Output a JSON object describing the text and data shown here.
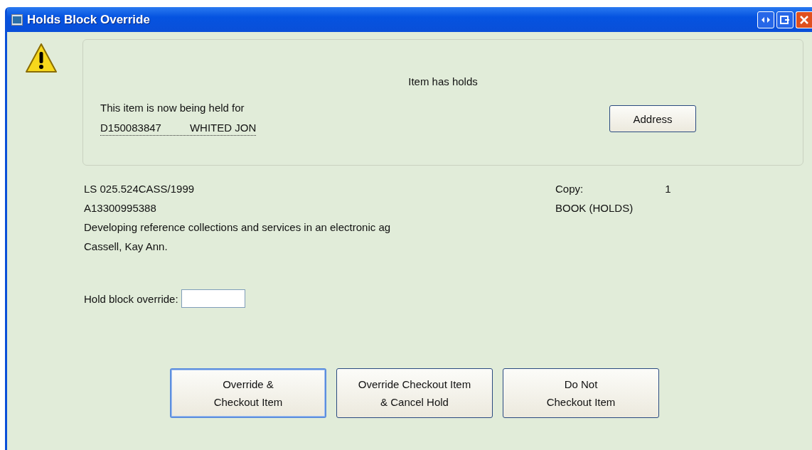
{
  "window": {
    "title": "Holds Block Override"
  },
  "holds_panel": {
    "heading": "Item has holds",
    "message": "This item is now being held for",
    "patron_id": "D150083847",
    "patron_name": "WHITED JON",
    "address_button": "Address"
  },
  "item": {
    "call_number": "LS 025.524CASS/1999",
    "barcode": "A13300995388",
    "title": "Developing reference collections and services in an electronic ag",
    "author": "Cassell, Kay Ann.",
    "copy_label": "Copy:",
    "copy_value": "1",
    "item_type": "BOOK (HOLDS)"
  },
  "override_field": {
    "label": "Hold block override:"
  },
  "buttons": [
    {
      "lines": [
        "Override &",
        "Checkout Item"
      ],
      "selected": true
    },
    {
      "lines": [
        "Override Checkout Item",
        "& Cancel Hold"
      ],
      "selected": false
    },
    {
      "lines": [
        "Do Not",
        "Checkout Item"
      ],
      "selected": false
    }
  ]
}
